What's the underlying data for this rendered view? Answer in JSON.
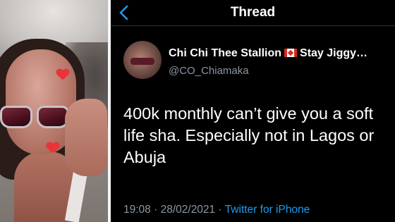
{
  "header": {
    "title": "Thread",
    "back_icon": "chevron-left-icon"
  },
  "tweet": {
    "author_name": "Chi Chi Thee Stallion",
    "author_suffix": "Stay Jiggy…",
    "flag_icon": "canada-flag-icon",
    "handle": "@CO_Chiamaka",
    "text": "400k monthly can’t give you a soft life sha. Especially not in Lagos or Abuja",
    "time": "19:08",
    "date": "28/02/2021",
    "separator": "·",
    "source": "Twitter for iPhone"
  },
  "colors": {
    "background": "#000000",
    "accent": "#1d9bf0",
    "secondary_text": "#8b98a5"
  }
}
